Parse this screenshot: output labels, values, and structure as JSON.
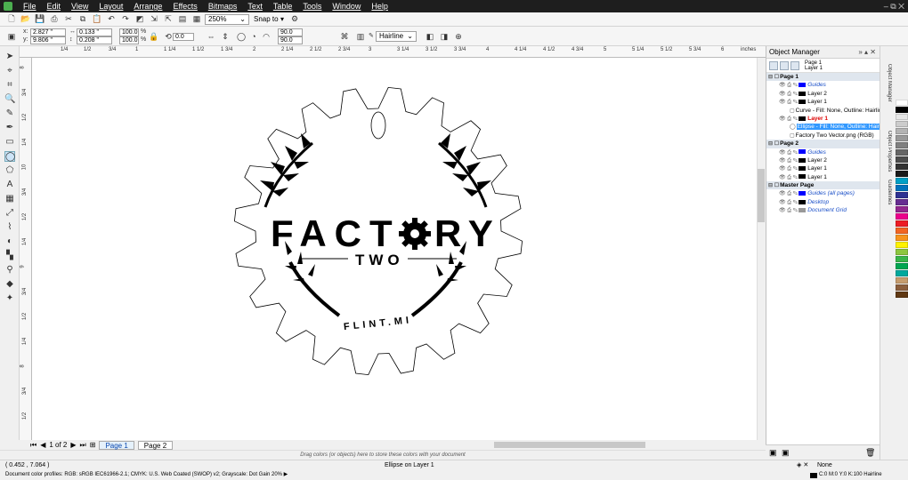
{
  "menu": [
    "File",
    "Edit",
    "View",
    "Layout",
    "Arrange",
    "Effects",
    "Bitmaps",
    "Text",
    "Table",
    "Tools",
    "Window",
    "Help"
  ],
  "window_controls": "– ⧉ ✕",
  "toolbar": {
    "zoom": "250%",
    "snap": "Snap to"
  },
  "props": {
    "x": "2.827 \"",
    "y": "9.806 \"",
    "w": "0.133 \"",
    "h": "0.208 \"",
    "sx": "100.0",
    "sy": "100.0",
    "pct": "%",
    "angle": "0.0",
    "a1": "90.0",
    "a2": "90.0",
    "outline": "Hairline"
  },
  "ruler": {
    "h_ticks": [
      "1/4",
      "1/2",
      "3/4",
      "1",
      "1 1/4",
      "1 1/2",
      "1 3/4",
      "2",
      "2 1/4",
      "2 1/2",
      "2 3/4",
      "3",
      "3 1/4",
      "3 1/2",
      "3 3/4",
      "4",
      "4 1/4",
      "4 1/2",
      "4 3/4",
      "5",
      "5 1/4",
      "5 1/2",
      "5 3/4",
      "6"
    ],
    "unit": "inches",
    "v_ticks": [
      "8",
      "3/4",
      "1/2",
      "1/4",
      "10",
      "3/4",
      "1/2",
      "1/4",
      "9",
      "3/4",
      "1/2",
      "1/4",
      "8",
      "3/4",
      "1/2"
    ]
  },
  "logo": {
    "line1": "FACT",
    "line1b": "RY",
    "line2": "TWO",
    "line3": "FLINT.MI"
  },
  "pages": {
    "counter": "1 of 2",
    "tabs": [
      "Page 1",
      "Page 2"
    ]
  },
  "color_hint": "Drag colors (or objects) here to store these colors with your document",
  "status": {
    "coords": "( 0.452 , 7.064 )",
    "selection": "Ellipse on Layer 1",
    "fill": "None",
    "outline": "C:0 M:0 Y:0 K:100  Hairline"
  },
  "profiles": "Document color profiles: RGB: sRGB IEC61966-2.1; CMYK: U.S. Web Coated (SWOP) v2; Grayscale: Dot Gain 20% ▶",
  "object_manager": {
    "title": "Object Manager",
    "current_page": "Page 1",
    "current_layer": "Layer 1",
    "rows": [
      {
        "t": "Page 1",
        "k": "page"
      },
      {
        "t": "Guides",
        "k": "blue",
        "c": "#0000ff"
      },
      {
        "t": "Layer 2",
        "k": "layer",
        "c": "#000000"
      },
      {
        "t": "Layer 1",
        "k": "layer",
        "c": "#000000"
      },
      {
        "t": "Curve - Fill: None, Outline: Hairline",
        "k": "obj"
      },
      {
        "t": "Layer 1",
        "k": "red",
        "c": "#000000"
      },
      {
        "t": "Ellipse - Fill: None, Outline: Hairline",
        "k": "sel"
      },
      {
        "t": "Factory Two Vector.png (RGB)",
        "k": "obj"
      },
      {
        "t": "Page 2",
        "k": "page"
      },
      {
        "t": "Guides",
        "k": "blue",
        "c": "#0000ff"
      },
      {
        "t": "Layer 2",
        "k": "layer",
        "c": "#000000"
      },
      {
        "t": "Layer 1",
        "k": "layer",
        "c": "#000000"
      },
      {
        "t": "Layer 1",
        "k": "layer",
        "c": "#000000"
      },
      {
        "t": "Master Page",
        "k": "page"
      },
      {
        "t": "Guides (all pages)",
        "k": "blue",
        "c": "#0000ff"
      },
      {
        "t": "Desktop",
        "k": "blue",
        "c": "#000000"
      },
      {
        "t": "Document Grid",
        "k": "blue",
        "c": "#999999"
      }
    ]
  },
  "docker_tabs": [
    "Object Manager",
    "Object Properties",
    "Guidelines"
  ],
  "palette": [
    "#ffffff",
    "#000000",
    "#e6e6e6",
    "#cccccc",
    "#b3b3b3",
    "#999999",
    "#808080",
    "#666666",
    "#4d4d4d",
    "#333333",
    "#1a1a1a",
    "#00a0c6",
    "#0072bc",
    "#2e3192",
    "#662d91",
    "#92278f",
    "#ec008c",
    "#ed1c24",
    "#f26522",
    "#f7941d",
    "#fff200",
    "#8dc63f",
    "#39b54a",
    "#00a651",
    "#00a99d",
    "#c69c6d",
    "#8b5e3c",
    "#603913"
  ]
}
